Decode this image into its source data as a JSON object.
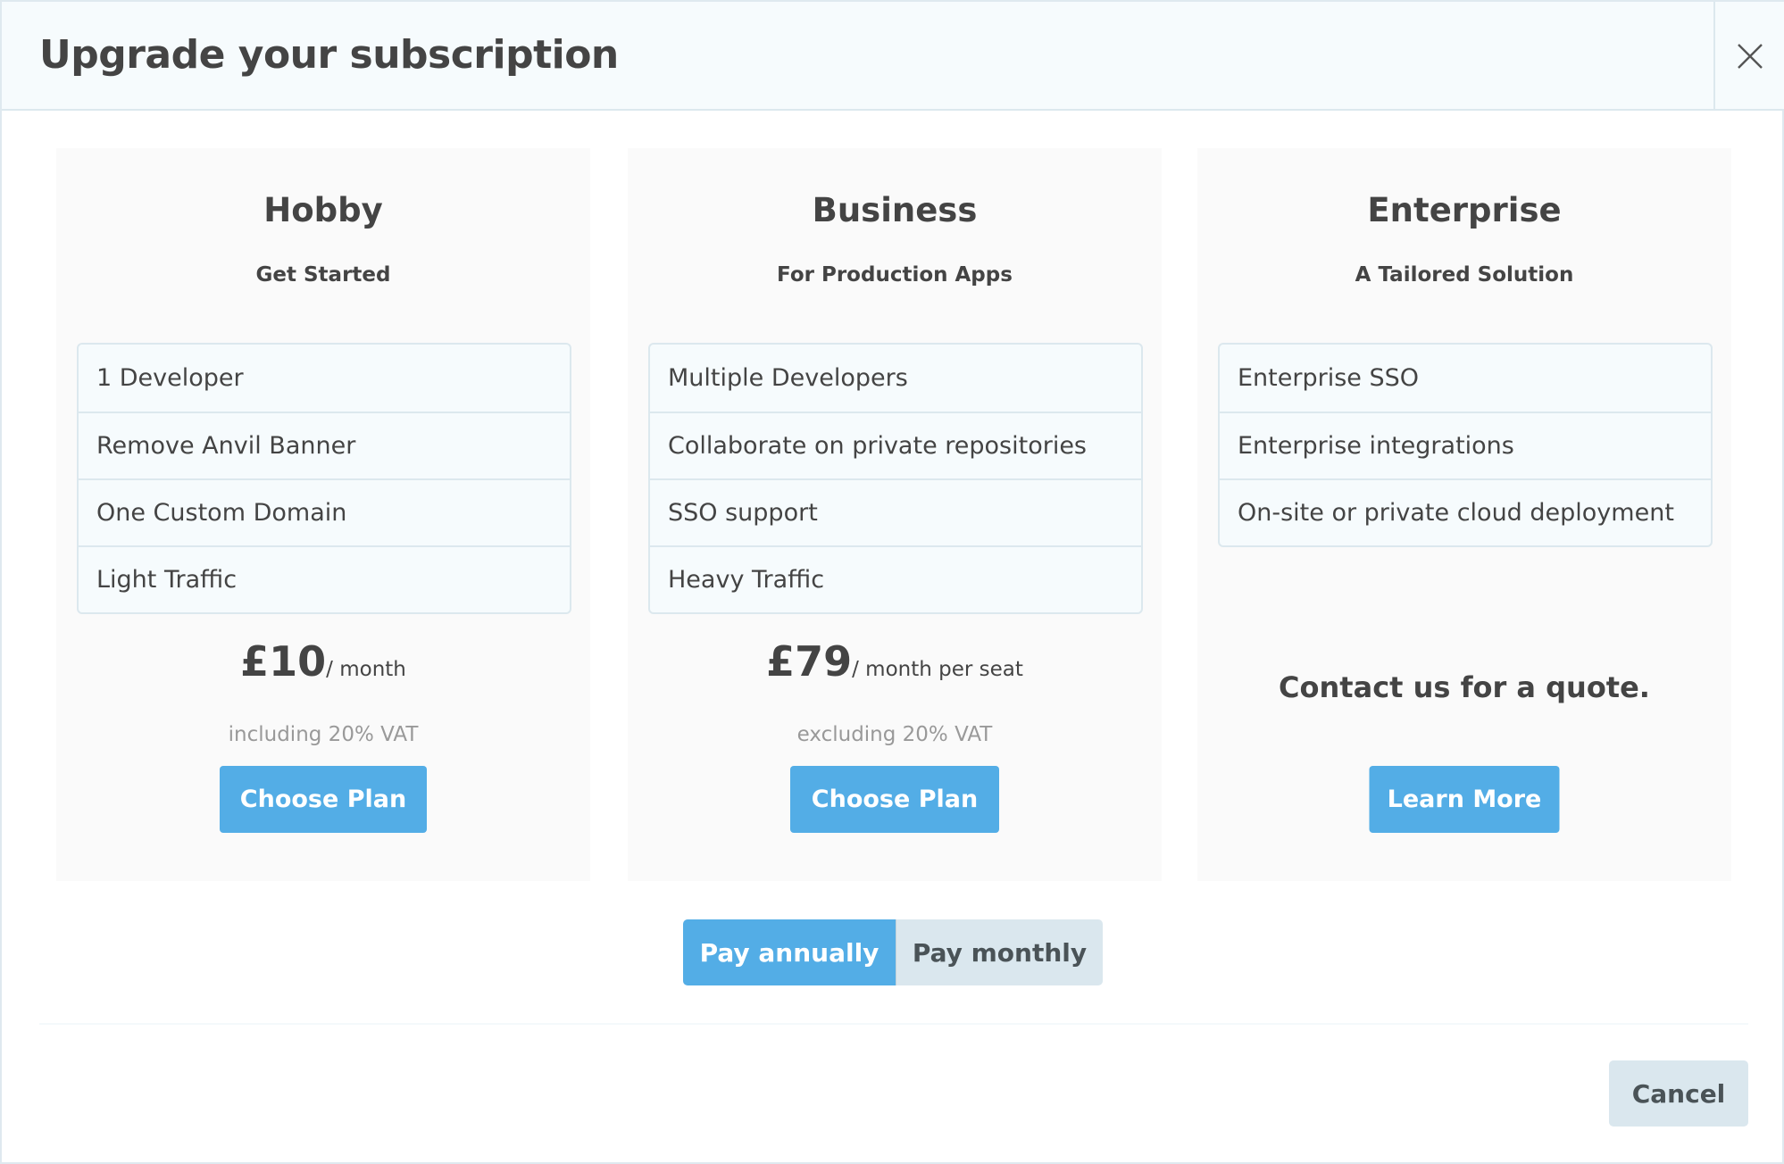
{
  "dialog": {
    "title": "Upgrade your subscription",
    "close_icon": "close-icon"
  },
  "plans": [
    {
      "name": "Hobby",
      "subtitle": "Get Started",
      "features": [
        "1 Developer",
        "Remove Anvil Banner",
        "One Custom Domain",
        "Light Traffic"
      ],
      "price": "£10",
      "period": "/ month",
      "vat": "including 20% VAT",
      "button": "Choose Plan"
    },
    {
      "name": "Business",
      "subtitle": "For Production Apps",
      "features": [
        "Multiple Developers",
        "Collaborate on private repositories",
        "SSO support",
        "Heavy Traffic"
      ],
      "price": "£79",
      "period": "/ month per seat",
      "vat": "excluding 20% VAT",
      "button": "Choose Plan"
    },
    {
      "name": "Enterprise",
      "subtitle": "A Tailored Solution",
      "features": [
        "Enterprise SSO",
        "Enterprise integrations",
        "On-site or private cloud deployment"
      ],
      "contact": "Contact us for a quote.",
      "button": "Learn More"
    }
  ],
  "billing": {
    "annual": "Pay annually",
    "monthly": "Pay monthly",
    "selected": "annual"
  },
  "footer": {
    "cancel": "Cancel"
  },
  "colors": {
    "accent": "#53ade6",
    "secondary": "#dae7ee"
  }
}
